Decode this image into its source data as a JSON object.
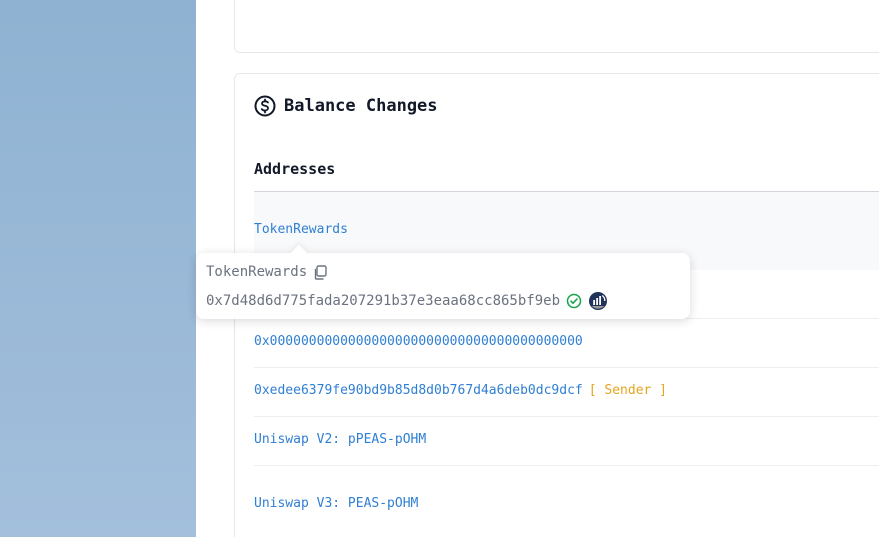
{
  "section": {
    "title": "Balance Changes",
    "icon": "dollar-circle-icon"
  },
  "table": {
    "column_header": "Addresses",
    "rows": [
      {
        "label": "TokenRewards",
        "tag": ""
      },
      {
        "label": "0x0000000000000000000000000000000000000000",
        "tag": ""
      },
      {
        "label": "0xedee6379fe90bd9b85d8d0b767d4a6deb0dc9dcf",
        "tag": "[ Sender ]"
      },
      {
        "label": "Uniswap V2: pPEAS-pOHM",
        "tag": ""
      },
      {
        "label": "Uniswap V3: PEAS-pOHM",
        "tag": ""
      }
    ]
  },
  "tooltip": {
    "name": "TokenRewards",
    "address": "0x7d48d6d775fada207291b37e3eaa68cc865bf9eb",
    "icons": [
      "copy-icon",
      "verified-check-icon",
      "analytics-icon"
    ]
  },
  "colors": {
    "link": "#2f7fd3",
    "sender_tag": "#e5a51e",
    "verified": "#16a34a",
    "left_panel": "#9bb9d8"
  }
}
